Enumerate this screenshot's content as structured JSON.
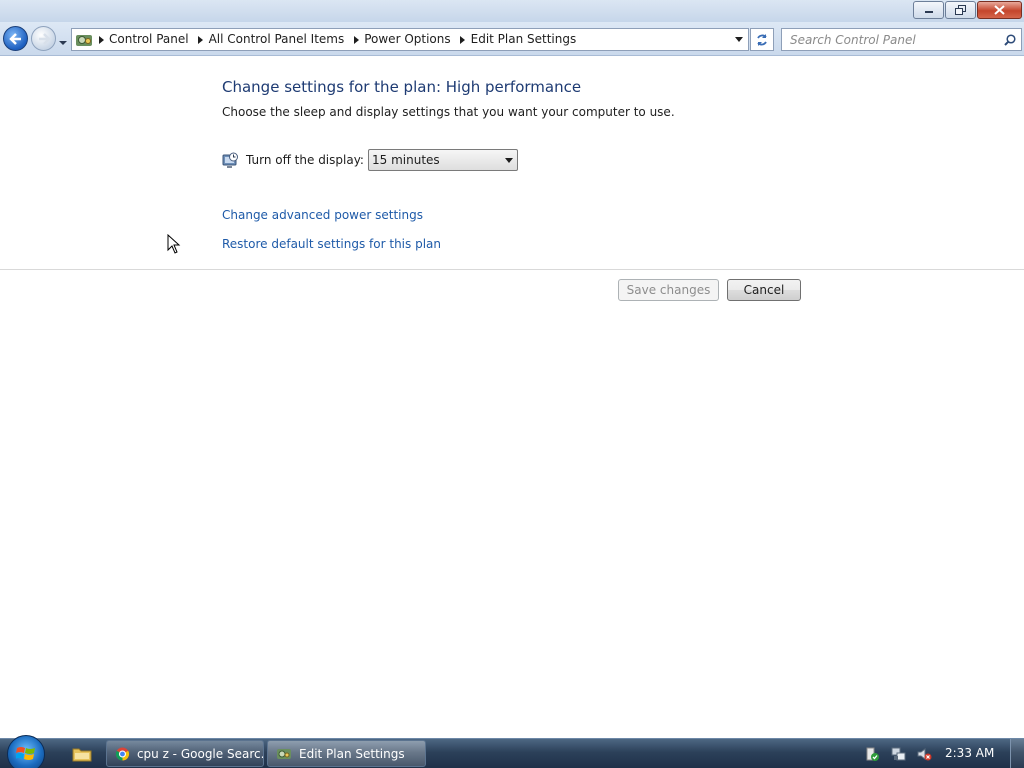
{
  "window": {
    "caption_buttons": [
      "minimize",
      "restore",
      "close"
    ]
  },
  "navigation": {
    "back_icon": "back-arrow-icon",
    "forward_icon": "forward-arrow-icon",
    "breadcrumbs": [
      "Control Panel",
      "All Control Panel Items",
      "Power Options",
      "Edit Plan Settings"
    ],
    "search_placeholder": "Search Control Panel"
  },
  "main": {
    "title": "Change settings for the plan: High performance",
    "subtitle": "Choose the sleep and display settings that you want your computer to use.",
    "display_setting": {
      "label": "Turn off the display:",
      "value": "15 minutes"
    },
    "links": {
      "advanced": "Change advanced power settings",
      "restore": "Restore default settings for this plan"
    },
    "buttons": {
      "save": "Save changes",
      "cancel": "Cancel"
    }
  },
  "taskbar": {
    "tasks": [
      {
        "label": "cpu z - Google Searc...",
        "icon": "chrome-icon"
      },
      {
        "label": "Edit Plan Settings",
        "icon": "control-panel-icon"
      }
    ],
    "clock": "2:33 AM"
  },
  "colors": {
    "title_text": "#1e3b73",
    "link_text": "#1e5aa8",
    "taskbar": "#2c415a"
  }
}
